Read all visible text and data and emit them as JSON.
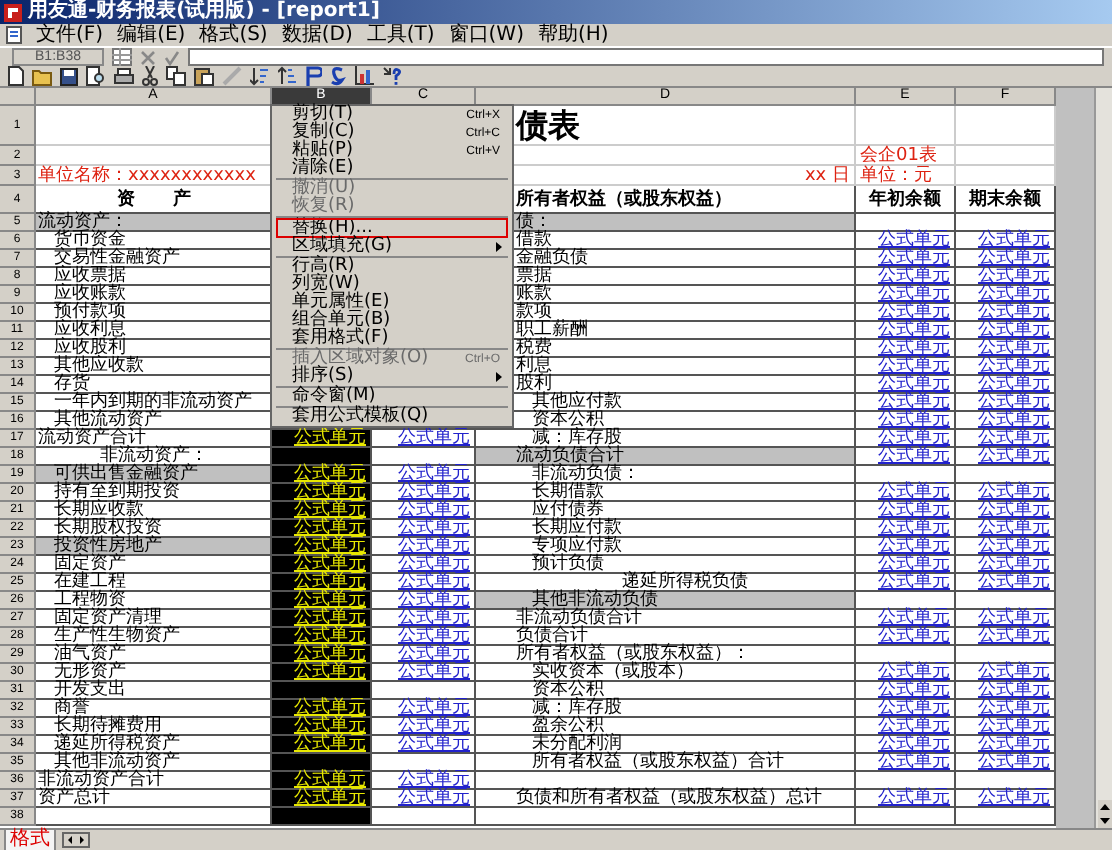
{
  "window": {
    "title": "用友通-财务报表(试用版) - [report1]"
  },
  "menu_bar": [
    "文件(F)",
    "编辑(E)",
    "格式(S)",
    "数据(D)",
    "工具(T)",
    "窗口(W)",
    "帮助(H)"
  ],
  "formula_bar": {
    "cell": "B1:B38"
  },
  "columns": [
    {
      "label": "A",
      "selected": false
    },
    {
      "label": "B",
      "selected": true
    },
    {
      "label": "C",
      "selected": false
    },
    {
      "label": "D",
      "selected": false
    },
    {
      "label": "E",
      "selected": false
    },
    {
      "label": "F",
      "selected": false
    }
  ],
  "rows": [
    {
      "num": "1",
      "kind": "title",
      "d": "债表"
    },
    {
      "num": "2",
      "kind": "note",
      "e": "会企01表"
    },
    {
      "num": "3",
      "kind": "note",
      "a": "单位名称：xxxxxxxxxxxx",
      "d": "xx 日",
      "e": "单位：元"
    },
    {
      "num": "4",
      "kind": "header",
      "a": "资 产",
      "d": "所有者权益（或股东权益）",
      "e": "年初余额",
      "f": "期末余额"
    },
    {
      "num": "5",
      "kind": "body",
      "a": {
        "text": "流动资产：",
        "kind": "total",
        "shaded": true
      },
      "d": {
        "text": "债：",
        "kind": "total",
        "shaded": true
      }
    },
    {
      "num": "6",
      "kind": "body",
      "a": {
        "text": "货币资金",
        "kind": "item",
        "shaded": false
      },
      "d": {
        "text": "借款",
        "kind": "total",
        "shaded": false
      },
      "e": "公式单元",
      "f": "公式单元"
    },
    {
      "num": "7",
      "kind": "body",
      "a": {
        "text": "交易性金融资产",
        "kind": "item",
        "shaded": false
      },
      "d": {
        "text": "金融负债",
        "kind": "total",
        "shaded": false
      },
      "e": "公式单元",
      "f": "公式单元"
    },
    {
      "num": "8",
      "kind": "body",
      "a": {
        "text": "应收票据",
        "kind": "item",
        "shaded": false
      },
      "d": {
        "text": "票据",
        "kind": "total",
        "shaded": false
      },
      "e": "公式单元",
      "f": "公式单元"
    },
    {
      "num": "9",
      "kind": "body",
      "a": {
        "text": "应收账款",
        "kind": "item",
        "shaded": false
      },
      "d": {
        "text": "账款",
        "kind": "total",
        "shaded": false
      },
      "e": "公式单元",
      "f": "公式单元"
    },
    {
      "num": "10",
      "kind": "body",
      "a": {
        "text": "预付款项",
        "kind": "item",
        "shaded": false
      },
      "d": {
        "text": "款项",
        "kind": "total",
        "shaded": false
      },
      "e": "公式单元",
      "f": "公式单元"
    },
    {
      "num": "11",
      "kind": "body",
      "a": {
        "text": "应收利息",
        "kind": "item",
        "shaded": false
      },
      "d": {
        "text": "职工薪酬",
        "kind": "total",
        "shaded": false
      },
      "e": "公式单元",
      "f": "公式单元"
    },
    {
      "num": "12",
      "kind": "body",
      "a": {
        "text": "应收股利",
        "kind": "item",
        "shaded": false
      },
      "d": {
        "text": "税费",
        "kind": "total",
        "shaded": false
      },
      "e": "公式单元",
      "f": "公式单元"
    },
    {
      "num": "13",
      "kind": "body",
      "a": {
        "text": "其他应收款",
        "kind": "item",
        "shaded": false
      },
      "d": {
        "text": "利息",
        "kind": "total",
        "shaded": false
      },
      "e": "公式单元",
      "f": "公式单元"
    },
    {
      "num": "14",
      "kind": "body",
      "a": {
        "text": "存货",
        "kind": "item",
        "shaded": false
      },
      "d": {
        "text": "股利",
        "kind": "total",
        "shaded": false
      },
      "e": "公式单元",
      "f": "公式单元"
    },
    {
      "num": "15",
      "kind": "body",
      "a": {
        "text": "一年内到期的非流动资产",
        "kind": "item",
        "shaded": false
      },
      "d": {
        "text": "其他应付款",
        "kind": "item",
        "shaded": false
      },
      "e": "公式单元",
      "f": "公式单元"
    },
    {
      "num": "16",
      "kind": "body",
      "a": {
        "text": "其他流动资产",
        "kind": "item",
        "shaded": false
      },
      "d": {
        "text": "资本公积",
        "kind": "item",
        "shaded": false
      },
      "e": "公式单元",
      "f": "公式单元"
    },
    {
      "num": "17",
      "kind": "body",
      "a": {
        "text": "流动资产合计",
        "kind": "total",
        "shaded": false
      },
      "b": "公式单元",
      "c": "公式单元",
      "d": {
        "text": "减：库存股",
        "kind": "item",
        "shaded": false
      },
      "e": "公式单元",
      "f": "公式单元"
    },
    {
      "num": "18",
      "kind": "body",
      "a": {
        "text": "非流动资产：",
        "kind": "center",
        "shaded": false
      },
      "d": {
        "text": "流动负债合计",
        "kind": "total",
        "shaded": true
      },
      "e": "公式单元",
      "f": "公式单元"
    },
    {
      "num": "19",
      "kind": "body",
      "a": {
        "text": "可供出售金融资产",
        "kind": "item",
        "shaded": true
      },
      "b": "公式单元",
      "c": "公式单元",
      "d": {
        "text": "非流动负债：",
        "kind": "item",
        "shaded": false
      }
    },
    {
      "num": "20",
      "kind": "body",
      "a": {
        "text": "持有至到期投资",
        "kind": "item",
        "shaded": false
      },
      "b": "公式单元",
      "c": "公式单元",
      "d": {
        "text": "长期借款",
        "kind": "item",
        "shaded": false
      },
      "e": "公式单元",
      "f": "公式单元"
    },
    {
      "num": "21",
      "kind": "body",
      "a": {
        "text": "长期应收款",
        "kind": "item",
        "shaded": false
      },
      "b": "公式单元",
      "c": "公式单元",
      "d": {
        "text": "应付债券",
        "kind": "item",
        "shaded": false
      },
      "e": "公式单元",
      "f": "公式单元"
    },
    {
      "num": "22",
      "kind": "body",
      "a": {
        "text": "长期股权投资",
        "kind": "item",
        "shaded": false
      },
      "b": "公式单元",
      "c": "公式单元",
      "d": {
        "text": "长期应付款",
        "kind": "item",
        "shaded": false
      },
      "e": "公式单元",
      "f": "公式单元"
    },
    {
      "num": "23",
      "kind": "body",
      "a": {
        "text": "投资性房地产",
        "kind": "item",
        "shaded": true
      },
      "b": "公式单元",
      "c": "公式单元",
      "d": {
        "text": "专项应付款",
        "kind": "item",
        "shaded": false
      },
      "e": "公式单元",
      "f": "公式单元"
    },
    {
      "num": "24",
      "kind": "body",
      "a": {
        "text": "固定资产",
        "kind": "item",
        "shaded": false
      },
      "b": "公式单元",
      "c": "公式单元",
      "d": {
        "text": "预计负债",
        "kind": "item",
        "shaded": false
      },
      "e": "公式单元",
      "f": "公式单元"
    },
    {
      "num": "25",
      "kind": "body",
      "a": {
        "text": "在建工程",
        "kind": "item",
        "shaded": false
      },
      "b": "公式单元",
      "c": "公式单元",
      "d": {
        "text": "递延所得税负债",
        "kind": "center",
        "shaded": false
      },
      "e": "公式单元",
      "f": "公式单元"
    },
    {
      "num": "26",
      "kind": "body",
      "a": {
        "text": "工程物资",
        "kind": "item",
        "shaded": false
      },
      "b": "公式单元",
      "c": "公式单元",
      "d": {
        "text": "其他非流动负债",
        "kind": "item",
        "shaded": true
      }
    },
    {
      "num": "27",
      "kind": "body",
      "a": {
        "text": "固定资产清理",
        "kind": "item",
        "shaded": false
      },
      "b": "公式单元",
      "c": "公式单元",
      "d": {
        "text": "非流动负债合计",
        "kind": "total",
        "shaded": false
      },
      "e": "公式单元",
      "f": "公式单元"
    },
    {
      "num": "28",
      "kind": "body",
      "a": {
        "text": "生产性生物资产",
        "kind": "item",
        "shaded": false
      },
      "b": "公式单元",
      "c": "公式单元",
      "d": {
        "text": "负债合计",
        "kind": "total",
        "shaded": false
      },
      "e": "公式单元",
      "f": "公式单元"
    },
    {
      "num": "29",
      "kind": "body",
      "a": {
        "text": "油气资产",
        "kind": "item",
        "shaded": false
      },
      "b": "公式单元",
      "c": "公式单元",
      "d": {
        "text": "所有者权益（或股东权益）：",
        "kind": "total",
        "shaded": false
      }
    },
    {
      "num": "30",
      "kind": "body",
      "a": {
        "text": "无形资产",
        "kind": "item",
        "shaded": false
      },
      "b": "公式单元",
      "c": "公式单元",
      "d": {
        "text": "实收资本（或股本）",
        "kind": "item",
        "shaded": false
      },
      "e": "公式单元",
      "f": "公式单元"
    },
    {
      "num": "31",
      "kind": "body",
      "a": {
        "text": "开发支出",
        "kind": "item",
        "shaded": false
      },
      "d": {
        "text": "资本公积",
        "kind": "item",
        "shaded": false
      },
      "e": "公式单元",
      "f": "公式单元"
    },
    {
      "num": "32",
      "kind": "body",
      "a": {
        "text": "商誉",
        "kind": "item",
        "shaded": false
      },
      "b": "公式单元",
      "c": "公式单元",
      "d": {
        "text": "减：库存股",
        "kind": "item",
        "shaded": false
      },
      "e": "公式单元",
      "f": "公式单元"
    },
    {
      "num": "33",
      "kind": "body",
      "a": {
        "text": "长期待摊费用",
        "kind": "item",
        "shaded": false
      },
      "b": "公式单元",
      "c": "公式单元",
      "d": {
        "text": "盈余公积",
        "kind": "item",
        "shaded": false
      },
      "e": "公式单元",
      "f": "公式单元"
    },
    {
      "num": "34",
      "kind": "body",
      "a": {
        "text": "递延所得税资产",
        "kind": "item",
        "shaded": false
      },
      "b": "公式单元",
      "c": "公式单元",
      "d": {
        "text": "未分配利润",
        "kind": "item",
        "shaded": false
      },
      "e": "公式单元",
      "f": "公式单元"
    },
    {
      "num": "35",
      "kind": "body",
      "a": {
        "text": "其他非流动资产",
        "kind": "item",
        "shaded": false
      },
      "d": {
        "text": "所有者权益（或股东权益）合计",
        "kind": "item",
        "shaded": false
      },
      "e": "公式单元",
      "f": "公式单元"
    },
    {
      "num": "36",
      "kind": "body",
      "a": {
        "text": "非流动资产合计",
        "kind": "total",
        "shaded": false
      },
      "b": "公式单元",
      "c": "公式单元"
    },
    {
      "num": "37",
      "kind": "body",
      "a": {
        "text": "资产总计",
        "kind": "total",
        "shaded": false
      },
      "b": "公式单元",
      "c": "公式单元",
      "d": {
        "text": "负债和所有者权益（或股东权益）总计",
        "kind": "total",
        "shaded": false
      },
      "e": "公式单元",
      "f": "公式单元"
    },
    {
      "num": "38",
      "kind": "body"
    }
  ],
  "context_menu": [
    {
      "kind": "item",
      "label": "剪切(T)",
      "shortcut": "Ctrl+X",
      "disabled": false,
      "selected": false,
      "submenu": false
    },
    {
      "kind": "item",
      "label": "复制(C)",
      "shortcut": "Ctrl+C",
      "disabled": false,
      "selected": false,
      "submenu": false
    },
    {
      "kind": "item",
      "label": "粘贴(P)",
      "shortcut": "Ctrl+V",
      "disabled": false,
      "selected": false,
      "submenu": false
    },
    {
      "kind": "item",
      "label": "清除(E)",
      "disabled": false,
      "selected": false,
      "submenu": false
    },
    {
      "kind": "separator"
    },
    {
      "kind": "item",
      "label": "撤消(U)",
      "disabled": true,
      "selected": false,
      "submenu": false
    },
    {
      "kind": "item",
      "label": "恢复(R)",
      "disabled": true,
      "selected": false,
      "submenu": false
    },
    {
      "kind": "separator"
    },
    {
      "kind": "item",
      "label": "替换(H)...",
      "disabled": false,
      "selected": true,
      "submenu": false
    },
    {
      "kind": "item",
      "label": "区域填充(G)",
      "disabled": false,
      "selected": false,
      "submenu": true
    },
    {
      "kind": "separator"
    },
    {
      "kind": "item",
      "label": "行高(R)",
      "disabled": false,
      "selected": false,
      "submenu": false
    },
    {
      "kind": "item",
      "label": "列宽(W)",
      "disabled": false,
      "selected": false,
      "submenu": false
    },
    {
      "kind": "item",
      "label": "单元属性(E)",
      "disabled": false,
      "selected": false,
      "submenu": false
    },
    {
      "kind": "item",
      "label": "组合单元(B)",
      "disabled": false,
      "selected": false,
      "submenu": false
    },
    {
      "kind": "item",
      "label": "套用格式(F)",
      "disabled": false,
      "selected": false,
      "submenu": false
    },
    {
      "kind": "separator"
    },
    {
      "kind": "item",
      "label": "插入区域对象(O)",
      "shortcut": "Ctrl+O",
      "disabled": true,
      "selected": false,
      "submenu": false
    },
    {
      "kind": "item",
      "label": "排序(S)",
      "disabled": false,
      "selected": false,
      "submenu": true
    },
    {
      "kind": "separator"
    },
    {
      "kind": "item",
      "label": "命令窗(M)",
      "disabled": false,
      "selected": false,
      "submenu": false
    },
    {
      "kind": "separator"
    },
    {
      "kind": "item",
      "label": "套用公式模板(Q)",
      "disabled": false,
      "selected": false,
      "submenu": false
    }
  ],
  "status_bar": {
    "mode": "格式"
  }
}
